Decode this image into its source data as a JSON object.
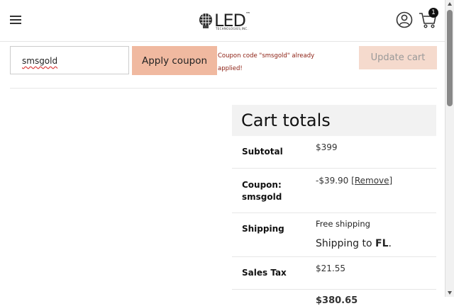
{
  "header": {
    "logo_text": "LED",
    "logo_trademark": "™",
    "logo_subtext": "TECHNOLOGIES,INC.",
    "cart_count": "1"
  },
  "coupon": {
    "input_value": "smsgold",
    "apply_label": "Apply coupon",
    "message": "Coupon code \"smsgold\" already applied!",
    "update_label": "Update cart"
  },
  "totals": {
    "title": "Cart totals",
    "subtotal_label": "Subtotal",
    "subtotal_value": "$399",
    "coupon_label_line1": "Coupon:",
    "coupon_label_line2": "smsgold",
    "coupon_value": "-$39.90",
    "remove_label": "[Remove]",
    "shipping_label": "Shipping",
    "shipping_method": "Free shipping",
    "shipping_to_prefix": "Shipping to",
    "shipping_to_state": "FL",
    "shipping_to_suffix": ".",
    "tax_label": "Sales Tax",
    "tax_value": "$21.55",
    "total_value": "$380.65"
  },
  "colors": {
    "apply_button": "#f0b9a0",
    "update_button": "#f5dacd",
    "coupon_message": "#8b1c0f"
  }
}
